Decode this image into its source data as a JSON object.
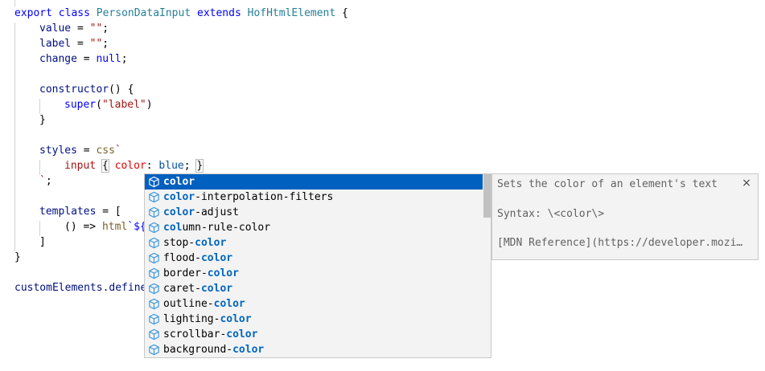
{
  "code": {
    "line_kw_export": "export",
    "line_kw_class": "class",
    "class_name": "PersonDataInput",
    "line_kw_extends": "extends",
    "base_class": "HofHtmlElement",
    "open_brace": "{",
    "value_name": "value",
    "value_eq": " = ",
    "value_str": "\"\"",
    "label_name": "label",
    "change_name": "change",
    "null_kw": "null",
    "semicolon": ";",
    "ctor_name": "constructor",
    "ctor_rest": "() {",
    "super_kw": "super",
    "super_arg": "\"label\"",
    "close_brace": "}",
    "styles_name": "styles",
    "css_tag": "css",
    "backtick": "`",
    "css_selector": "input",
    "css_open": "{",
    "css_prop": "color",
    "css_colon": ":",
    "css_value": "blue",
    "css_semi": ";",
    "css_close": "}",
    "tmpl_end": "`;",
    "templates_name": "templates",
    "templates_open": " = [",
    "arrow": "() =>",
    "html_tag": "html",
    "tmpl_start": "`${",
    "array_close": "]",
    "define_line": "customElements.define"
  },
  "suggest": {
    "items": [
      {
        "match": "color",
        "rest": "",
        "prefix": ""
      },
      {
        "match": "color",
        "rest": "-interpolation-filters",
        "prefix": ""
      },
      {
        "match": "color",
        "rest": "-adjust",
        "prefix": ""
      },
      {
        "match": "col",
        "rest": "umn-rule-color",
        "prefix": ""
      },
      {
        "match": "color",
        "rest": "",
        "prefix": "stop-"
      },
      {
        "match": "color",
        "rest": "",
        "prefix": "flood-"
      },
      {
        "match": "color",
        "rest": "",
        "prefix": "border-"
      },
      {
        "match": "color",
        "rest": "",
        "prefix": "caret-"
      },
      {
        "match": "color",
        "rest": "",
        "prefix": "outline-"
      },
      {
        "match": "color",
        "rest": "",
        "prefix": "lighting-"
      },
      {
        "match": "color",
        "rest": "",
        "prefix": "scrollbar-"
      },
      {
        "match": "color",
        "rest": "",
        "prefix": "background-"
      }
    ],
    "selected_index": 0,
    "icon": "property-cube-icon"
  },
  "details": {
    "description": "Sets the color of an element's text",
    "syntax": "Syntax: \\<color\\>",
    "reference": "[MDN Reference](https://developer.mozi…",
    "close_glyph": "×"
  },
  "colors": {
    "keyword": "#0000ff",
    "type": "#267f99",
    "variable": "#001080",
    "string": "#a31515",
    "selection": "#0060c0",
    "match": "#0066bf"
  }
}
